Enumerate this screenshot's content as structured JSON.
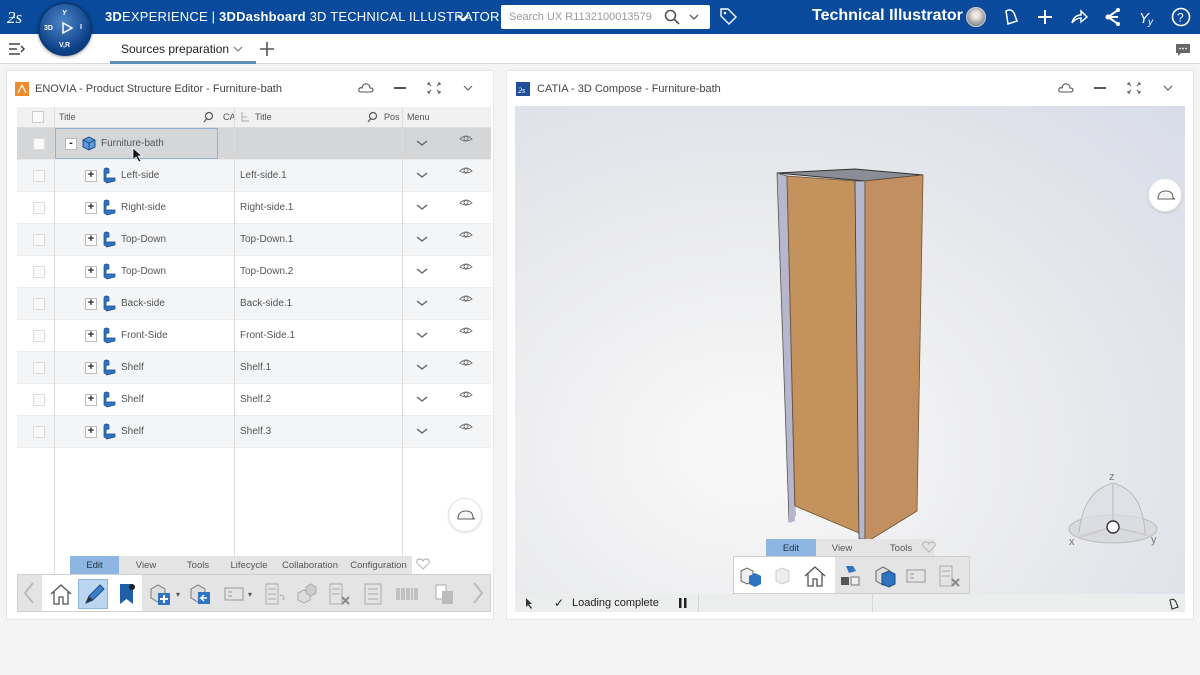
{
  "topbar": {
    "brand_bold": "3D",
    "brand_light": "EXPERIENCE",
    "separator": " | ",
    "dashboard_bold": "3DDashboard",
    "app_name": " 3D TECHNICAL ILLUSTRATOR",
    "search_placeholder": "Search UX R1132100013579",
    "user_role": "Technical Illustrator",
    "icons": [
      "ds-logo-icon",
      "compass-icon",
      "chevron-down-icon",
      "search-icon",
      "tag-icon",
      "avatar",
      "notification-bell-icon",
      "add-icon",
      "share-icon",
      "collaborate-icon",
      "community-icon",
      "help-icon"
    ]
  },
  "compass": {
    "top": "Y",
    "left": "3D",
    "right": "I",
    "bottom": "V,R"
  },
  "tabbar": {
    "tabs": [
      {
        "label": "Sources preparation",
        "active": true
      }
    ],
    "add_tab": "+"
  },
  "left_panel": {
    "title": "ENOVIA - Product Structure Editor - Furniture-bath",
    "columns": {
      "title1": "Title",
      "ca": "CA",
      "title2": "Title",
      "pos": "Pos",
      "menu": "Menu"
    },
    "rows": [
      {
        "title": "Furniture-bath",
        "instance": "",
        "expander": "-",
        "selected": true
      },
      {
        "title": "Left-side",
        "instance": "Left-side.1",
        "expander": "+"
      },
      {
        "title": "Right-side",
        "instance": "Right-side.1",
        "expander": "+"
      },
      {
        "title": "Top-Down",
        "instance": "Top-Down.1",
        "expander": "+"
      },
      {
        "title": "Top-Down",
        "instance": "Top-Down.2",
        "expander": "+"
      },
      {
        "title": "Back-side",
        "instance": "Back-side.1",
        "expander": "+"
      },
      {
        "title": "Front-Side",
        "instance": "Front-Side.1",
        "expander": "+"
      },
      {
        "title": "Shelf",
        "instance": "Shelf.1",
        "expander": "+"
      },
      {
        "title": "Shelf",
        "instance": "Shelf.2",
        "expander": "+"
      },
      {
        "title": "Shelf",
        "instance": "Shelf.3",
        "expander": "+"
      }
    ],
    "action_tabs": [
      "Edit",
      "View",
      "Tools",
      "Lifecycle",
      "Collaboration",
      "Configuration"
    ],
    "active_action_tab": "Edit"
  },
  "right_panel": {
    "title": "CATIA - 3D Compose - Furniture-bath",
    "action_tabs": [
      "Edit",
      "View",
      "Tools"
    ],
    "active_action_tab": "Edit",
    "status": "Loading complete",
    "compass_axes": {
      "x": "x",
      "y": "y",
      "z": "z"
    }
  },
  "colors": {
    "topbar": "#0a4a9c",
    "active_tab": "#8db6e3",
    "wood": "#c4925c",
    "part_icon": "#2f74c0"
  }
}
